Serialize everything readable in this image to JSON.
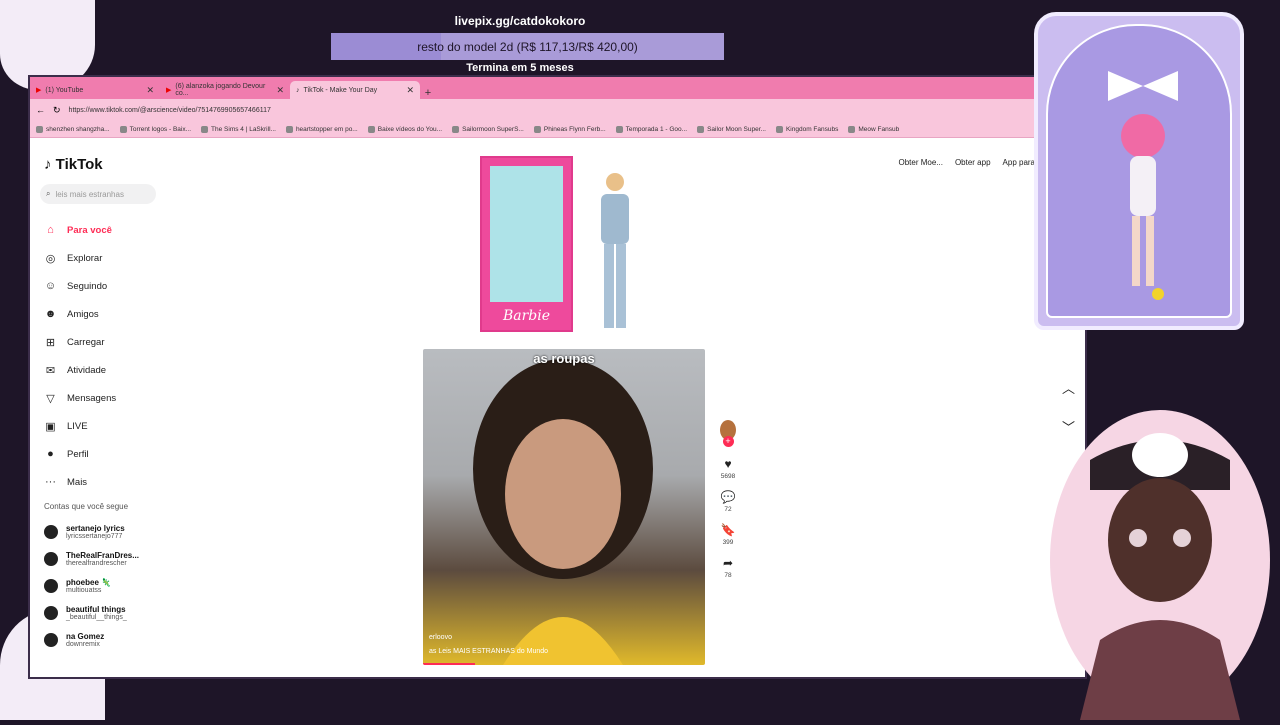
{
  "overlay": {
    "livepix_url": "livepix.gg/catdokokoro",
    "goal_text": "resto do model 2d (R$ 117,13/R$ 420,00)",
    "goal_progress": 0.279,
    "goal_ends": "Termina em 5 meses"
  },
  "browser": {
    "tabs": [
      {
        "label": "(1) YouTube",
        "icon": "youtube-icon"
      },
      {
        "label": "(6) alanzoka jogando Devour co...",
        "icon": "youtube-icon"
      },
      {
        "label": "TikTok - Make Your Day",
        "icon": "tiktok-icon",
        "active": true
      }
    ],
    "new_tab": "+",
    "url": "https://www.tiktok.com/@arscience/video/7514769905657466117",
    "bookmarks": [
      "shenzhen shangzha...",
      "Torrent logos - Baix...",
      "The Sims 4 | LaSkrill...",
      "heartstopper em po...",
      "Baixe vídeos do You...",
      "Sailormoon SuperS...",
      "Phineas Flynn Ferb...",
      "Temporada 1 - Goo...",
      "Sailor Moon Super...",
      "Kingdom Fansubs",
      "Meow Fansub"
    ]
  },
  "tiktok": {
    "logo": "TikTok",
    "search_placeholder": "leis mais estranhas",
    "nav": [
      {
        "label": "Para você",
        "icon": "home-icon",
        "active": true
      },
      {
        "label": "Explorar",
        "icon": "compass-icon"
      },
      {
        "label": "Seguindo",
        "icon": "following-icon"
      },
      {
        "label": "Amigos",
        "icon": "friends-icon"
      },
      {
        "label": "Carregar",
        "icon": "upload-icon"
      },
      {
        "label": "Atividade",
        "icon": "activity-icon"
      },
      {
        "label": "Mensagens",
        "icon": "messages-icon"
      },
      {
        "label": "LIVE",
        "icon": "live-icon"
      },
      {
        "label": "Perfil",
        "icon": "profile-icon"
      },
      {
        "label": "Mais",
        "icon": "more-icon"
      }
    ],
    "following_title": "Contas que você segue",
    "following": [
      {
        "name": "sertanejo lyrics",
        "handle": "lyricssertanejo777"
      },
      {
        "name": "TheRealFranDres...",
        "handle": "therealfrandrescher"
      },
      {
        "name": "phoebee 🦎",
        "handle": "multiouatss"
      },
      {
        "name": "beautiful things",
        "handle": "_beautiful__things_"
      },
      {
        "name": "na Gomez",
        "handle": "downremix"
      }
    ],
    "top_links": [
      "Obter Moe...",
      "Obter app",
      "App para"
    ],
    "box_brand": "Barbie",
    "video": {
      "caption": "as roupas",
      "username": "erloovo",
      "description": "as Leis MAIS ESTRANHAS do Mundo"
    },
    "actions": [
      {
        "icon": "heart-icon",
        "count": "5698"
      },
      {
        "icon": "comment-icon",
        "count": "72"
      },
      {
        "icon": "bookmark-icon",
        "count": "399"
      },
      {
        "icon": "share-icon",
        "count": "78"
      }
    ]
  }
}
